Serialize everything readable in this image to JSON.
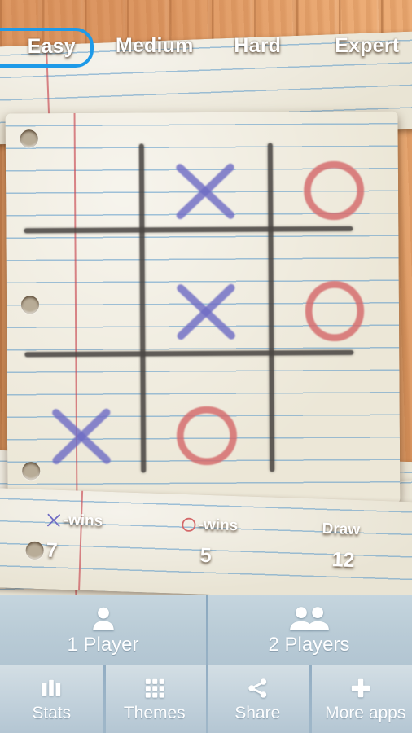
{
  "colors": {
    "accent_selected": "#1e9ae8",
    "mark_x": "#6f6cc4",
    "mark_o": "#d4696a",
    "grid_line": "#4b4744",
    "bottom_bar": "#b9cbd6",
    "paper": "#ece7d7",
    "wood": "#e3a069"
  },
  "difficulty": {
    "tabs": [
      {
        "label": "Easy",
        "selected": true
      },
      {
        "label": "Medium",
        "selected": false
      },
      {
        "label": "Hard",
        "selected": false
      },
      {
        "label": "Expert",
        "selected": false
      }
    ]
  },
  "board": {
    "rows": 3,
    "cols": 3,
    "cells": [
      {
        "row": 0,
        "col": 0,
        "mark": ""
      },
      {
        "row": 0,
        "col": 1,
        "mark": "X"
      },
      {
        "row": 0,
        "col": 2,
        "mark": "O"
      },
      {
        "row": 1,
        "col": 0,
        "mark": ""
      },
      {
        "row": 1,
        "col": 1,
        "mark": "X"
      },
      {
        "row": 1,
        "col": 2,
        "mark": "O"
      },
      {
        "row": 2,
        "col": 0,
        "mark": "X"
      },
      {
        "row": 2,
        "col": 1,
        "mark": "O"
      },
      {
        "row": 2,
        "col": 2,
        "mark": ""
      }
    ]
  },
  "scores": {
    "x_wins": {
      "glyph": "X",
      "label": "-wins",
      "value": "7"
    },
    "o_wins": {
      "glyph": "O",
      "label": "-wins",
      "value": "5"
    },
    "draw": {
      "label": "Draw",
      "value": "12"
    }
  },
  "player_modes": [
    {
      "label": "1 Player",
      "icon": "single-person-icon"
    },
    {
      "label": "2 Players",
      "icon": "two-people-icon"
    }
  ],
  "toolbar": [
    {
      "label": "Stats",
      "icon": "bar-chart-icon"
    },
    {
      "label": "Themes",
      "icon": "grid-icon"
    },
    {
      "label": "Share",
      "icon": "share-icon"
    },
    {
      "label": "More apps",
      "icon": "plus-icon"
    }
  ]
}
